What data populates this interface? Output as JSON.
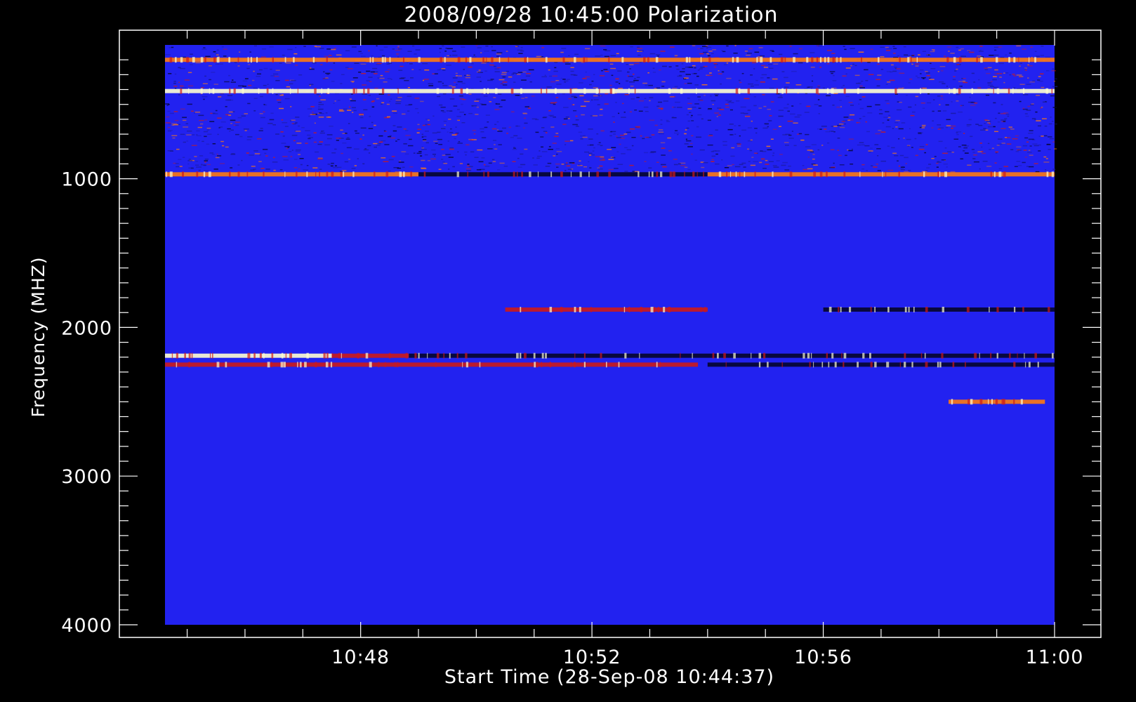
{
  "chart_data": {
    "type": "heatmap",
    "title": "2008/09/28 10:45:00 Polarization",
    "xlabel": "Start Time (28-Sep-08 10:44:37)",
    "ylabel": "Frequency (MHZ)",
    "x_start": "10:44:37",
    "x_end": "11:00:00",
    "x_ticks": [
      "10:48",
      "10:52",
      "10:56",
      "11:00"
    ],
    "y_range_mhz": [
      100,
      4000
    ],
    "y_ticks": [
      1000,
      2000,
      3000,
      4000
    ],
    "y_axis_inverted": true,
    "grid": false,
    "colors": {
      "background": "#000000",
      "axis": "#ffffff",
      "base": "#2222f0",
      "noise_dark": "#1a1a9a",
      "emission_red": "#cc1a1a",
      "emission_orange": "#ff7a10",
      "emission_white": "#ffffd0",
      "absorption": "#05052a"
    },
    "features": [
      {
        "kind": "noise_band",
        "freq_mhz": [
          100,
          950
        ],
        "intensity": "mixed"
      },
      {
        "kind": "line",
        "freq_mhz": 200,
        "color": "emission_orange",
        "time": [
          "10:44:37",
          "11:00:00"
        ]
      },
      {
        "kind": "line",
        "freq_mhz": 410,
        "color": "emission_white",
        "time": [
          "10:44:37",
          "11:00:00"
        ]
      },
      {
        "kind": "line",
        "freq_mhz": 970,
        "color": "emission_orange",
        "time": [
          "10:44:37",
          "10:49:00"
        ]
      },
      {
        "kind": "line",
        "freq_mhz": 970,
        "color": "absorption",
        "time": [
          "10:49:00",
          "10:54:00"
        ]
      },
      {
        "kind": "line",
        "freq_mhz": 970,
        "color": "emission_orange",
        "time": [
          "10:54:00",
          "11:00:00"
        ]
      },
      {
        "kind": "line",
        "freq_mhz": 1880,
        "color": "emission_red",
        "time": [
          "10:50:30",
          "10:54:00"
        ]
      },
      {
        "kind": "line",
        "freq_mhz": 1880,
        "color": "absorption",
        "time": [
          "10:56:00",
          "11:00:00"
        ]
      },
      {
        "kind": "line",
        "freq_mhz": 2190,
        "color": "emission_white",
        "time": [
          "10:44:37",
          "10:47:30"
        ]
      },
      {
        "kind": "line",
        "freq_mhz": 2190,
        "color": "emission_red",
        "time": [
          "10:47:30",
          "10:48:50"
        ]
      },
      {
        "kind": "line",
        "freq_mhz": 2190,
        "color": "absorption",
        "time": [
          "10:48:50",
          "11:00:00"
        ]
      },
      {
        "kind": "line",
        "freq_mhz": 2250,
        "color": "emission_red",
        "time": [
          "10:44:37",
          "10:53:50"
        ]
      },
      {
        "kind": "line",
        "freq_mhz": 2250,
        "color": "absorption",
        "time": [
          "10:54:00",
          "11:00:00"
        ]
      },
      {
        "kind": "line",
        "freq_mhz": 2500,
        "color": "emission_orange",
        "time": [
          "10:58:10",
          "10:59:50"
        ]
      }
    ]
  }
}
